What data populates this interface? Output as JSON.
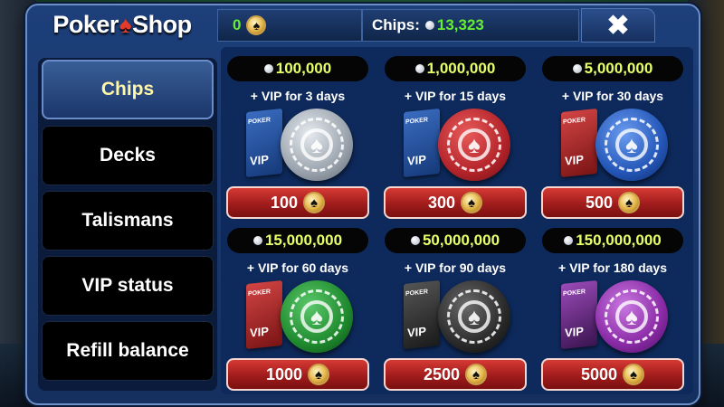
{
  "header": {
    "logo_left": "Poker",
    "logo_right": "Shop",
    "coins_value": "0",
    "chips_label": "Chips:",
    "chips_value": "13,323",
    "close_label": "✖"
  },
  "sidebar": {
    "items": [
      {
        "label": "Chips",
        "active": true
      },
      {
        "label": "Decks",
        "active": false
      },
      {
        "label": "Talismans",
        "active": false
      },
      {
        "label": "VIP status",
        "active": false
      },
      {
        "label": "Refill balance",
        "active": false
      }
    ]
  },
  "offers": [
    {
      "chips": "100,000",
      "vip": "+ VIP for 3 days",
      "price": "100",
      "color": "#9aa3ad"
    },
    {
      "chips": "1,000,000",
      "vip": "+ VIP for 15 days",
      "price": "300",
      "color": "#b3242a"
    },
    {
      "chips": "5,000,000",
      "vip": "+ VIP for 30 days",
      "price": "500",
      "color": "#2456b8"
    },
    {
      "chips": "15,000,000",
      "vip": "+ VIP for 60 days",
      "price": "1000",
      "color": "#1f8a2e"
    },
    {
      "chips": "50,000,000",
      "vip": "+ VIP for 90 days",
      "price": "2500",
      "color": "#2a2a2a"
    },
    {
      "chips": "150,000,000",
      "vip": "+ VIP for 180 days",
      "price": "5000",
      "color": "#8a2aa6"
    }
  ],
  "icons": {
    "spade": "♠",
    "coin": "spade-coin-icon",
    "gem": "chip-gem-icon",
    "close": "close-icon"
  },
  "colors": {
    "accent_green": "#66ee33",
    "amount_yellow": "#e8ff6a",
    "active_tab_text": "#fff6a8",
    "buy_button_red": "#b3242a"
  }
}
